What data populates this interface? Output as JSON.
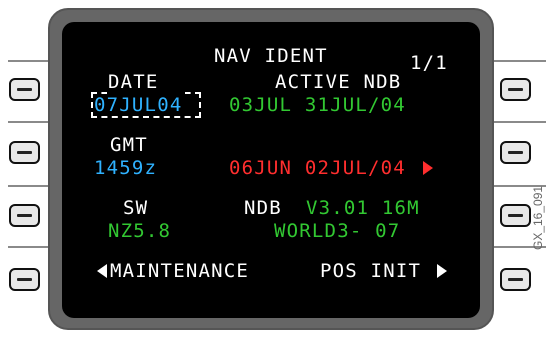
{
  "page": {
    "title": "NAV IDENT",
    "page_number": "1/1"
  },
  "left": {
    "date_label": "DATE",
    "date_value": "07JUL04",
    "gmt_label": "GMT",
    "gmt_value": "1459z",
    "sw_label": "SW",
    "sw_value": "NZ5.8",
    "maintenance": "MAINTENANCE"
  },
  "right": {
    "active_ndb_label": "ACTIVE NDB",
    "active_ndb_range": "03JUL 31JUL/04",
    "inactive_ndb_range": "06JUN 02JUL/04",
    "ndb_label": "NDB",
    "ndb_version": "V3.01 16M",
    "ndb_database": "WORLD3- 07",
    "pos_init": "POS INIT"
  },
  "figure_id": "GX_16_091",
  "colors": {
    "white": "#ffffff",
    "green": "#32c832",
    "cyan": "#2fb2ff",
    "red": "#ff2e2e",
    "bezel": "#666666",
    "screen": "#000000"
  },
  "icons": {
    "line_select_key": "horizontal-bar-icon",
    "page_arrow_right": "triangle-right-icon",
    "page_arrow_left": "triangle-left-icon"
  }
}
